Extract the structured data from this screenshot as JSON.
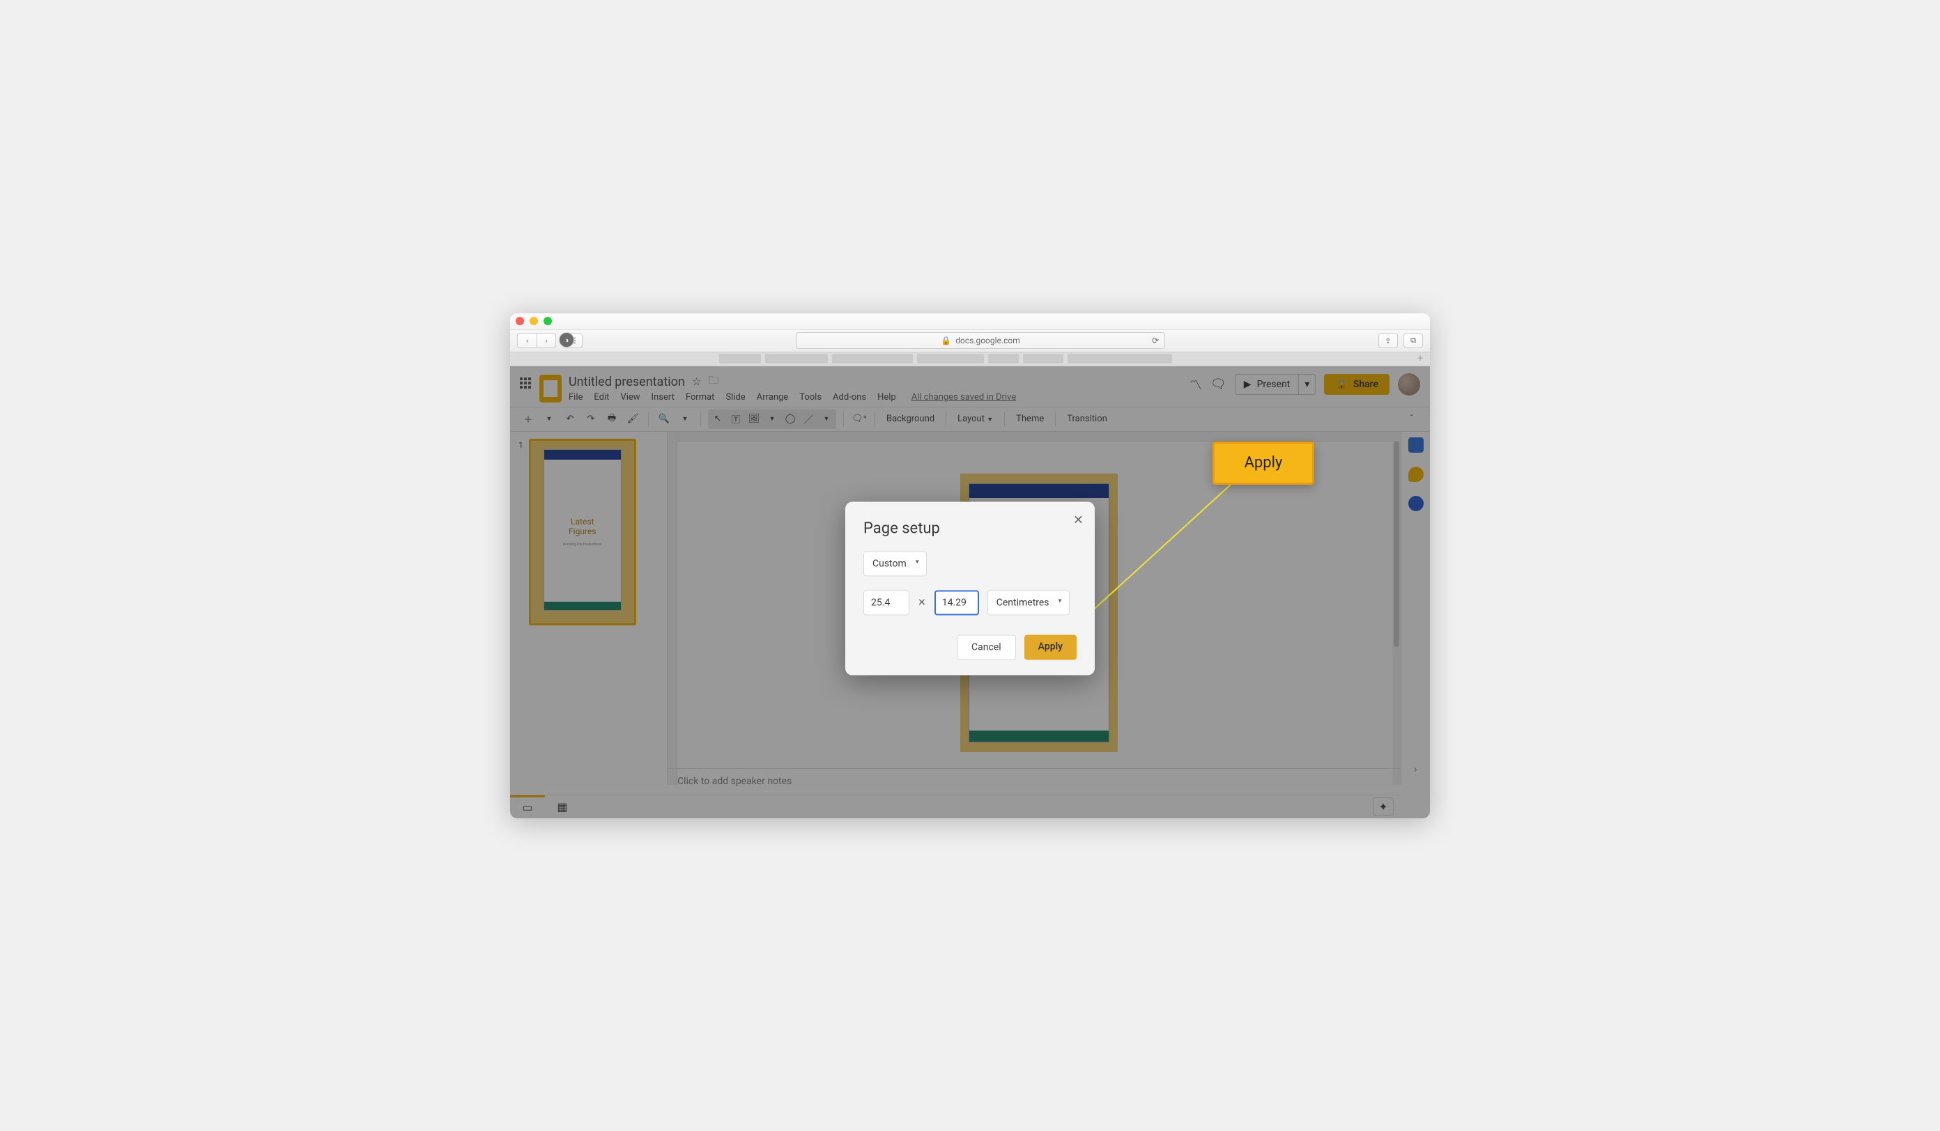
{
  "browser": {
    "url": "docs.google.com"
  },
  "doc": {
    "title": "Untitled presentation",
    "changes": "All changes saved in Drive"
  },
  "menus": {
    "file": "File",
    "edit": "Edit",
    "view": "View",
    "insert": "Insert",
    "format": "Format",
    "slide": "Slide",
    "arrange": "Arrange",
    "tools": "Tools",
    "addons": "Add-ons",
    "help": "Help"
  },
  "toolbar": {
    "background": "Background",
    "layout": "Layout",
    "theme": "Theme",
    "transition": "Transition"
  },
  "actions": {
    "present": "Present",
    "share": "Share"
  },
  "thumb": {
    "number": "1",
    "title_l1": "Latest",
    "title_l2": "Figures",
    "sub": "Running Fox Productions"
  },
  "notes": {
    "placeholder": "Click to add speaker notes"
  },
  "dialog": {
    "title": "Page setup",
    "preset": "Custom",
    "width": "25.4",
    "height": "14.29",
    "units": "Centimetres",
    "cancel": "Cancel",
    "apply": "Apply"
  },
  "callout": {
    "label": "Apply"
  }
}
